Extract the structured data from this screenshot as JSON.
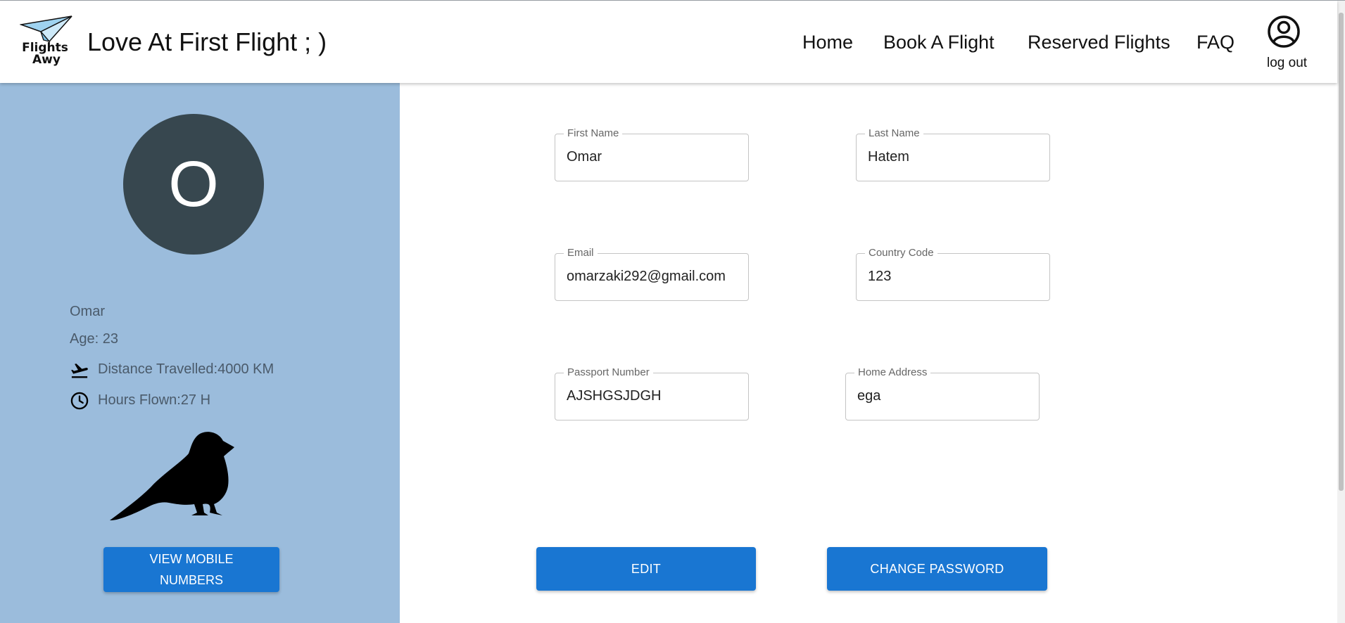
{
  "header": {
    "logo_line1": "Flights",
    "logo_line2": "Awy",
    "tagline": "Love At First Flight ; )",
    "nav": [
      {
        "label": "Home"
      },
      {
        "label": "Book A Flight"
      },
      {
        "label": "Reserved Flights"
      },
      {
        "label": "FAQ"
      }
    ],
    "logout_label": "log out",
    "icons": {
      "logo": "paper-plane-icon",
      "logout": "account-circle-icon"
    }
  },
  "sidebar": {
    "avatar_initial": "O",
    "name": "Omar",
    "age": "Age: 23",
    "distance": "Distance Travelled:4000 KM",
    "hours": "Hours Flown:27 H",
    "mobile_button": "VIEW MOBILE NUMBERS",
    "icons": {
      "distance": "flight-takeoff-icon",
      "hours": "clock-icon",
      "illustration": "bird-icon"
    },
    "colors": {
      "background": "#9bbcdc",
      "avatar": "#37474f"
    }
  },
  "form": {
    "first_name": {
      "label": "First Name",
      "value": "Omar"
    },
    "last_name": {
      "label": "Last Name",
      "value": "Hatem"
    },
    "email": {
      "label": "Email",
      "value": "omarzaki292@gmail.com"
    },
    "country_code": {
      "label": "Country Code",
      "value": "123"
    },
    "passport": {
      "label": "Passport Number",
      "value": "AJSHGSJDGH"
    },
    "address": {
      "label": "Home Address",
      "value": "ega"
    },
    "edit_button": "EDIT",
    "change_password_button": "CHANGE PASSWORD"
  },
  "colors": {
    "primary_button": "#1976d2"
  }
}
